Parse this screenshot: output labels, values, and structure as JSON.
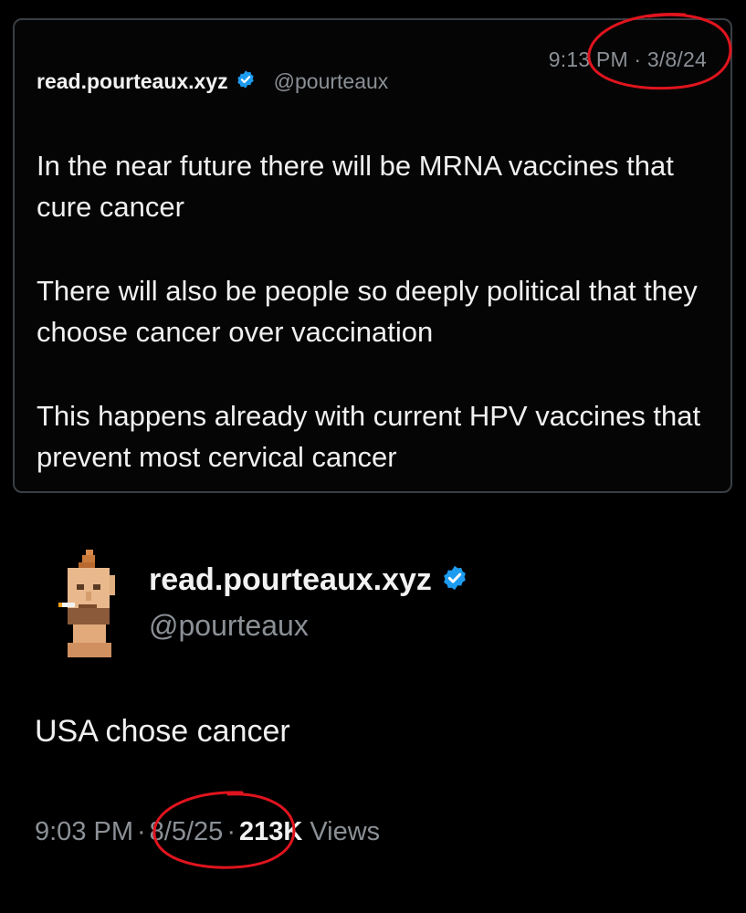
{
  "quoted_tweet": {
    "display_name": "read.pourteaux.xyz",
    "handle": "@pourteaux",
    "timestamp": "9:13 PM · 3/8/24",
    "paragraphs": [
      "In the near future there will be MRNA vaccines that cure cancer",
      "There will also be people so deeply political that they choose cancer over vaccination",
      "This happens already with current HPV vaccines that prevent most cervical cancer"
    ]
  },
  "main_tweet": {
    "display_name": "read.pourteaux.xyz",
    "handle": "@pourteaux",
    "text": "USA chose cancer",
    "time": "9:03 PM",
    "separator": "·",
    "date": "8/5/25",
    "views_count": "213K",
    "views_label": "Views"
  },
  "colors": {
    "background": "#000000",
    "verified_badge": "#1d9bf0",
    "annotation_circle": "#e0141e",
    "muted_text": "#8b9096"
  }
}
